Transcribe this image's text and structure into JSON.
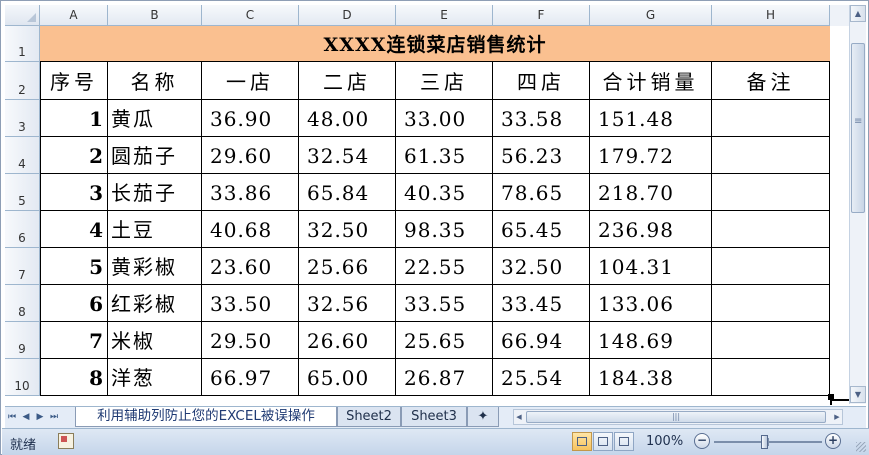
{
  "column_headers": [
    "A",
    "B",
    "C",
    "D",
    "E",
    "F",
    "G",
    "H"
  ],
  "row_headers": [
    "1",
    "2",
    "3",
    "4",
    "5",
    "6",
    "7",
    "8",
    "9",
    "10"
  ],
  "title": "XXXX连锁菜店销售统计",
  "table_headers": [
    "序号",
    "名称",
    "一店",
    "二店",
    "三店",
    "四店",
    "合计销量",
    "备注"
  ],
  "rows": [
    {
      "no": "1",
      "name": "黄瓜",
      "s1": "36.90",
      "s2": "48.00",
      "s3": "33.00",
      "s4": "33.58",
      "total": "151.48",
      "note": ""
    },
    {
      "no": "2",
      "name": "圆茄子",
      "s1": "29.60",
      "s2": "32.54",
      "s3": "61.35",
      "s4": "56.23",
      "total": "179.72",
      "note": ""
    },
    {
      "no": "3",
      "name": "长茄子",
      "s1": "33.86",
      "s2": "65.84",
      "s3": "40.35",
      "s4": "78.65",
      "total": "218.70",
      "note": ""
    },
    {
      "no": "4",
      "name": "土豆",
      "s1": "40.68",
      "s2": "32.50",
      "s3": "98.35",
      "s4": "65.45",
      "total": "236.98",
      "note": ""
    },
    {
      "no": "5",
      "name": "黄彩椒",
      "s1": "23.60",
      "s2": "25.66",
      "s3": "22.55",
      "s4": "32.50",
      "total": "104.31",
      "note": ""
    },
    {
      "no": "6",
      "name": "红彩椒",
      "s1": "33.50",
      "s2": "32.56",
      "s3": "33.55",
      "s4": "33.45",
      "total": "133.06",
      "note": ""
    },
    {
      "no": "7",
      "name": "米椒",
      "s1": "29.50",
      "s2": "26.60",
      "s3": "25.65",
      "s4": "66.94",
      "total": "148.69",
      "note": ""
    },
    {
      "no": "8",
      "name": "洋葱",
      "s1": "66.97",
      "s2": "65.00",
      "s3": "26.87",
      "s4": "25.54",
      "total": "184.38",
      "note": ""
    }
  ],
  "sheet_tabs": [
    "利用辅助列防止您的EXCEL被误操作",
    "Sheet2",
    "Sheet3"
  ],
  "status": {
    "ready": "就绪",
    "zoom": "100%",
    "zoom_level_percent": 100
  },
  "colors": {
    "title_fill": "#fac090",
    "header_bg": "#e3e9f2",
    "grid": "#000000"
  }
}
